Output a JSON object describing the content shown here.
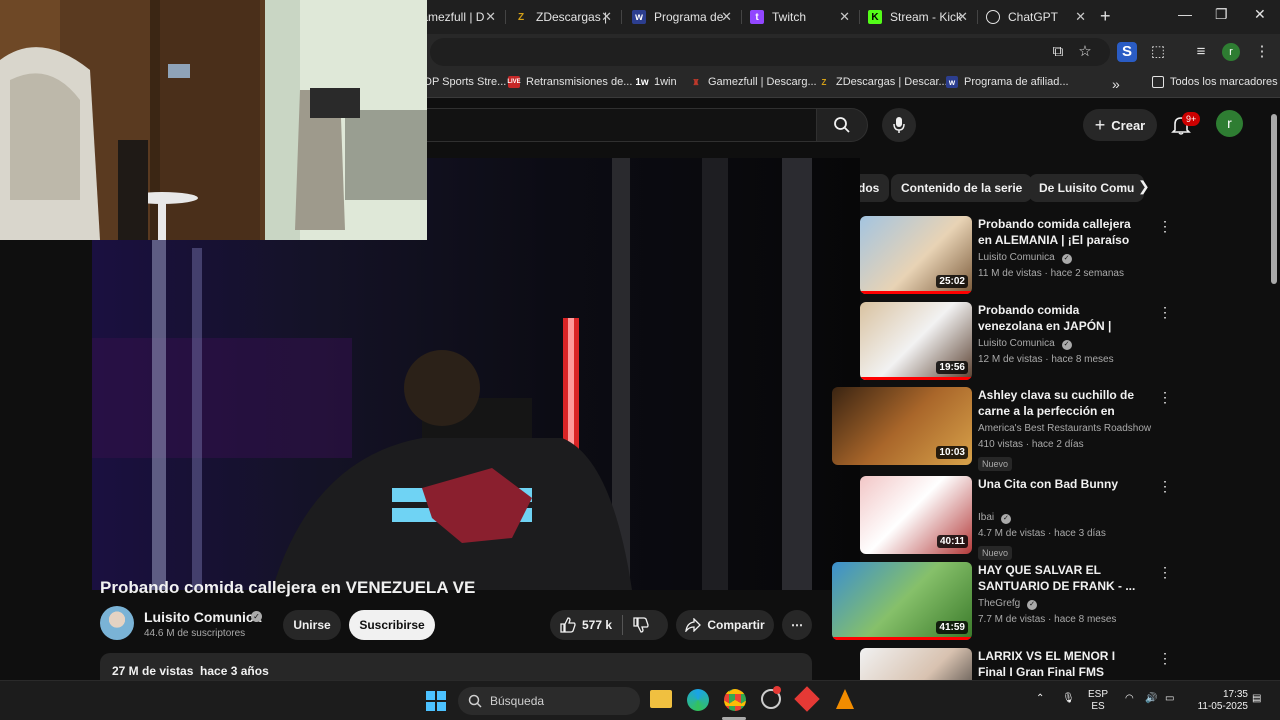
{
  "browser": {
    "tabs": [
      {
        "title": "Gamezfull | D",
        "favicon_color": "#c0392b"
      },
      {
        "title": "ZDescargas |",
        "favicon_color": "#d4a017"
      },
      {
        "title": "Programa de",
        "favicon_color": "#2c3e8f"
      },
      {
        "title": "Twitch",
        "favicon_color": "#9146ff"
      },
      {
        "title": "Stream - Kick",
        "favicon_color": "#53fc18"
      },
      {
        "title": "ChatGPT",
        "favicon_color": "#e3e3e3"
      }
    ],
    "profile_initial": "r",
    "bookmarks": [
      {
        "label": "DP Sports Stre..."
      },
      {
        "label": "Retransmisiones de..."
      },
      {
        "label": "1win"
      },
      {
        "label": "Gamezfull | Descarg..."
      },
      {
        "label": "ZDescargas | Descar..."
      },
      {
        "label": "Programa de afiliad..."
      }
    ],
    "all_bookmarks": "Todos los marcadores"
  },
  "youtube": {
    "create_label": "Crear",
    "notifications_badge": "9+",
    "avatar_initial": "r",
    "chips": [
      "dos",
      "Contenido de la serie",
      "De Luisito Comu"
    ],
    "video": {
      "title": "Probando comida callejera en VENEZUELA VE",
      "channel": "Luisito Comunica",
      "subscribers": "44.6 M de suscriptores",
      "join_label": "Unirse",
      "subscribe_label": "Suscribirse",
      "likes": "577 k",
      "share_label": "Compartir",
      "views": "27 M de vistas",
      "age": "hace 3 años"
    },
    "recommendations": [
      {
        "title": "Probando comida callejera en ALEMANIA | ¡El paraíso de la ...",
        "channel": "Luisito Comunica",
        "verified": true,
        "meta": "11 M de vistas · hace 2 semanas",
        "duration": "25:02",
        "new": "",
        "watched": 1.0
      },
      {
        "title": "Probando comida venezolana en JAPÓN | ¿Arepas con ...",
        "channel": "Luisito Comunica",
        "verified": true,
        "meta": "12 M de vistas · hace 8 meses",
        "duration": "19:56",
        "new": "",
        "watched": 1.0
      },
      {
        "title": "Ashley clava su cuchillo de carne a la perfección en Bandi...",
        "channel": "America's Best Restaurants Roadshow",
        "verified": false,
        "meta": "410 vistas · hace 2 días",
        "duration": "10:03",
        "new": "Nuevo",
        "watched": 0
      },
      {
        "title": "Una Cita con Bad Bunny",
        "channel": "Ibai",
        "verified": true,
        "meta": "4.7 M de vistas · hace 3 días",
        "duration": "40:11",
        "new": "Nuevo",
        "watched": 0
      },
      {
        "title": "HAY QUE SALVAR EL SANTUARIO DE FRANK - ...",
        "channel": "TheGrefg",
        "verified": true,
        "meta": "7.7 M de vistas · hace 8 meses",
        "duration": "41:59",
        "new": "",
        "watched": 1.0
      },
      {
        "title": "LARRIX VS EL MENOR I Final I Gran Final FMS Internacional ...",
        "channel": "",
        "verified": false,
        "meta": "",
        "duration": "",
        "new": "",
        "watched": 0
      }
    ]
  },
  "taskbar": {
    "search_placeholder": "Búsqueda",
    "lang_top": "ESP",
    "lang_bottom": "ES",
    "time": "17:35",
    "date": "11-05-2025"
  },
  "colors": {
    "accent_red": "#ff0000",
    "bg": "#0f0f0f",
    "chip_bg": "#272727"
  }
}
